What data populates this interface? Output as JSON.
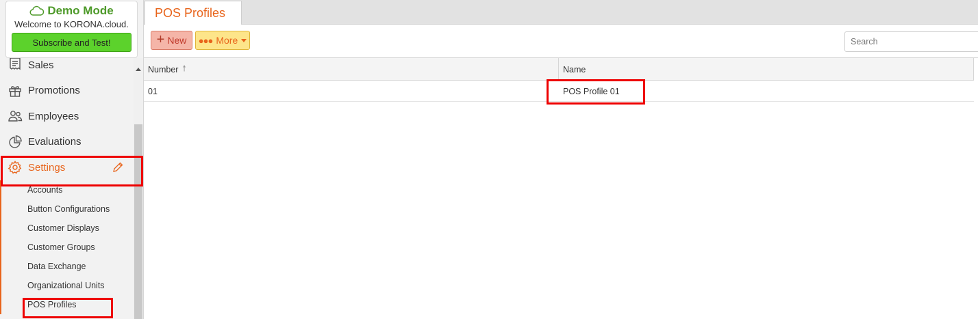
{
  "demo": {
    "title": "Demo Mode",
    "welcome": "Welcome to KORONA.cloud.",
    "subscribe_label": "Subscribe and Test!"
  },
  "nav": {
    "items": [
      {
        "label": "Sales",
        "icon": "receipt-icon"
      },
      {
        "label": "Promotions",
        "icon": "gift-icon"
      },
      {
        "label": "Employees",
        "icon": "users-icon"
      },
      {
        "label": "Evaluations",
        "icon": "pie-chart-icon"
      },
      {
        "label": "Settings",
        "icon": "gear-icon",
        "active": true
      }
    ],
    "settings_sub": [
      "Accounts",
      "Button Configurations",
      "Customer Displays",
      "Customer Groups",
      "Data Exchange",
      "Organizational Units",
      "POS Profiles"
    ]
  },
  "tab": {
    "title": "POS Profiles"
  },
  "toolbar": {
    "new_label": "New",
    "more_label": "More",
    "search_placeholder": "Search"
  },
  "grid": {
    "columns": [
      "Number",
      "Name"
    ],
    "rows": [
      {
        "number": "01",
        "name": "POS Profile 01"
      }
    ]
  },
  "colors": {
    "accent": "#e8641b",
    "demo_green": "#4e9a2a",
    "subscribe_green": "#5cd22c",
    "highlight_red": "#ee0000"
  }
}
